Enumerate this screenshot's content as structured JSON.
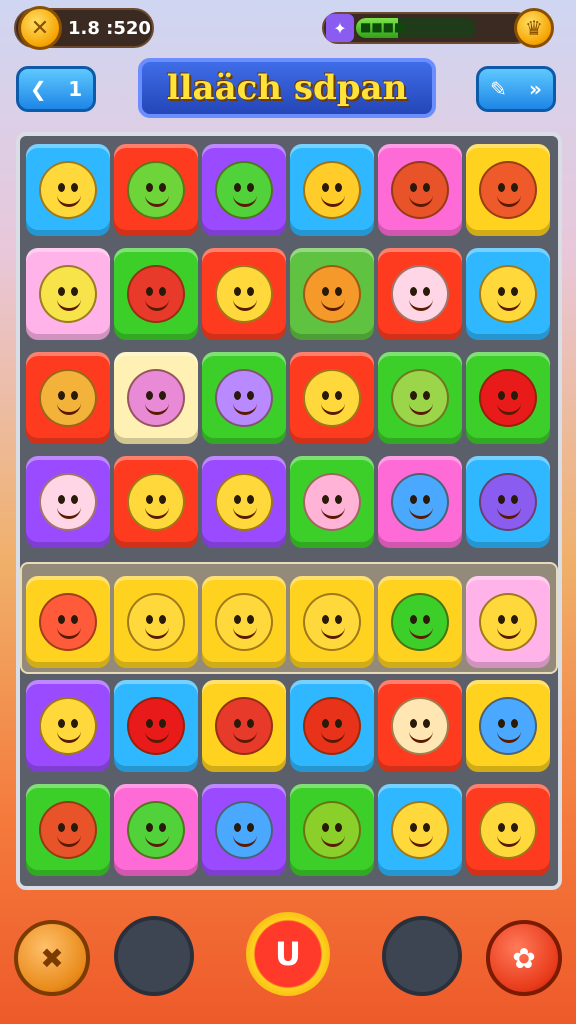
{
  "hud": {
    "coins": "1.8 :520",
    "energy_label": "■■■■",
    "energy_level": 0.35
  },
  "header": {
    "back_label": "1",
    "title": "llaäch sdpan"
  },
  "board": {
    "rows": [
      [
        "#2fb8ff",
        "#ff3b1f",
        "#9b4bff",
        "#2fb8ff",
        "#ff6bd6",
        "#ffd21f"
      ],
      [
        "#ffb3e9",
        "#3ccf2a",
        "#ff3b1f",
        "#5fc341",
        "#ff3b1f",
        "#2fb8ff"
      ],
      [
        "#ff3b1f",
        "#fff1b3",
        "#3ccf2a",
        "#ff3b1f",
        "#3ccf2a",
        "#3ccf2a"
      ],
      [
        "#9b4bff",
        "#ff3b1f",
        "#9b4bff",
        "#3ccf2a",
        "#ff6bd6",
        "#2fb8ff"
      ],
      [
        "#ffd21f",
        "#ffd21f",
        "#ffd21f",
        "#ffd21f",
        "#ffd21f",
        "#ffb3e9"
      ],
      [
        "#9b4bff",
        "#2fb8ff",
        "#ffd21f",
        "#2fb8ff",
        "#ff3b1f",
        "#ffd21f"
      ],
      [
        "#3ccf2a",
        "#ff6bd6",
        "#9b4bff",
        "#3ccf2a",
        "#2fb8ff",
        "#ff3b1f"
      ]
    ],
    "faces": [
      [
        "#ffd93b",
        "#6dd43a",
        "#52d23a",
        "#ffcc2a",
        "#e8532a",
        "#ee5a2a"
      ],
      [
        "#f7e34a",
        "#e83a2a",
        "#ffd93b",
        "#f59a2a",
        "#ffd6e6",
        "#ffd93b"
      ],
      [
        "#f3b23a",
        "#e88ad6",
        "#b98aff",
        "#ffd93b",
        "#9bd54a",
        "#e81a1a"
      ],
      [
        "#ffd6e6",
        "#ffd93b",
        "#ffd93b",
        "#ffb3d6",
        "#4aa8ff",
        "#8a5cf0"
      ],
      [
        "#ff5a3a",
        "#ffd93b",
        "#ffd93b",
        "#ffd93b",
        "#3ccf2a",
        "#ffd93b"
      ],
      [
        "#ffd93b",
        "#e81a1a",
        "#e83a2a",
        "#e8321a",
        "#ffe6b3",
        "#4aa8ff"
      ],
      [
        "#e8532a",
        "#52d23a",
        "#4aa8ff",
        "#8acf2a",
        "#ffd93b",
        "#ffd93b"
      ]
    ]
  },
  "controls": {
    "center_label": "U"
  }
}
